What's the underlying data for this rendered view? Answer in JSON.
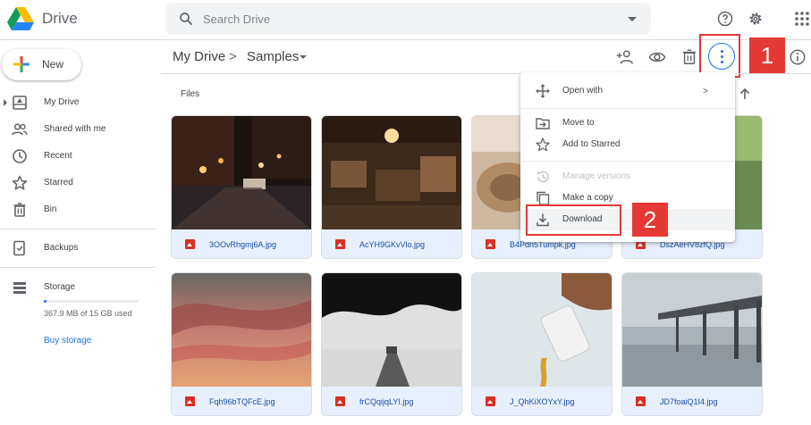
{
  "app": {
    "title": "Drive"
  },
  "search": {
    "placeholder": "Search Drive"
  },
  "sidebar": {
    "new_label": "New",
    "items": [
      {
        "label": "My Drive"
      },
      {
        "label": "Shared with me"
      },
      {
        "label": "Recent"
      },
      {
        "label": "Starred"
      },
      {
        "label": "Bin"
      },
      {
        "label": "Backups"
      },
      {
        "label": "Storage"
      }
    ],
    "storage_used": "367.9 MB of 15 GB used",
    "storage_fraction": 0.024,
    "buy_storage": "Buy storage"
  },
  "breadcrumb": {
    "root": "My Drive",
    "separator": ">",
    "current": "Samples"
  },
  "files_label": "Files",
  "files": [
    {
      "name": "3OOvRhgmj6A.jpg"
    },
    {
      "name": "AcYH9GKvVlo.jpg"
    },
    {
      "name": "B4Pdn5Tumpk.jpg"
    },
    {
      "name": "DszAeHV8zfQ.jpg"
    },
    {
      "name": "Fqh96bTQFcE.jpg"
    },
    {
      "name": "frCQqijqLYI.jpg"
    },
    {
      "name": "J_QhKiXOYxY.jpg"
    },
    {
      "name": "JD7foaiQ1I4.jpg"
    }
  ],
  "context_menu": {
    "open_with": "Open with",
    "submenu_arrow": ">",
    "move_to": "Move to",
    "add_to_starred": "Add to Starred",
    "manage_versions": "Manage versions",
    "make_a_copy": "Make a copy",
    "download": "Download"
  },
  "annotations": {
    "step1": "1",
    "step2": "2"
  },
  "colors": {
    "accent": "#1a73e8",
    "highlight": "#e53935",
    "name_bar": "#e8f0fe"
  }
}
